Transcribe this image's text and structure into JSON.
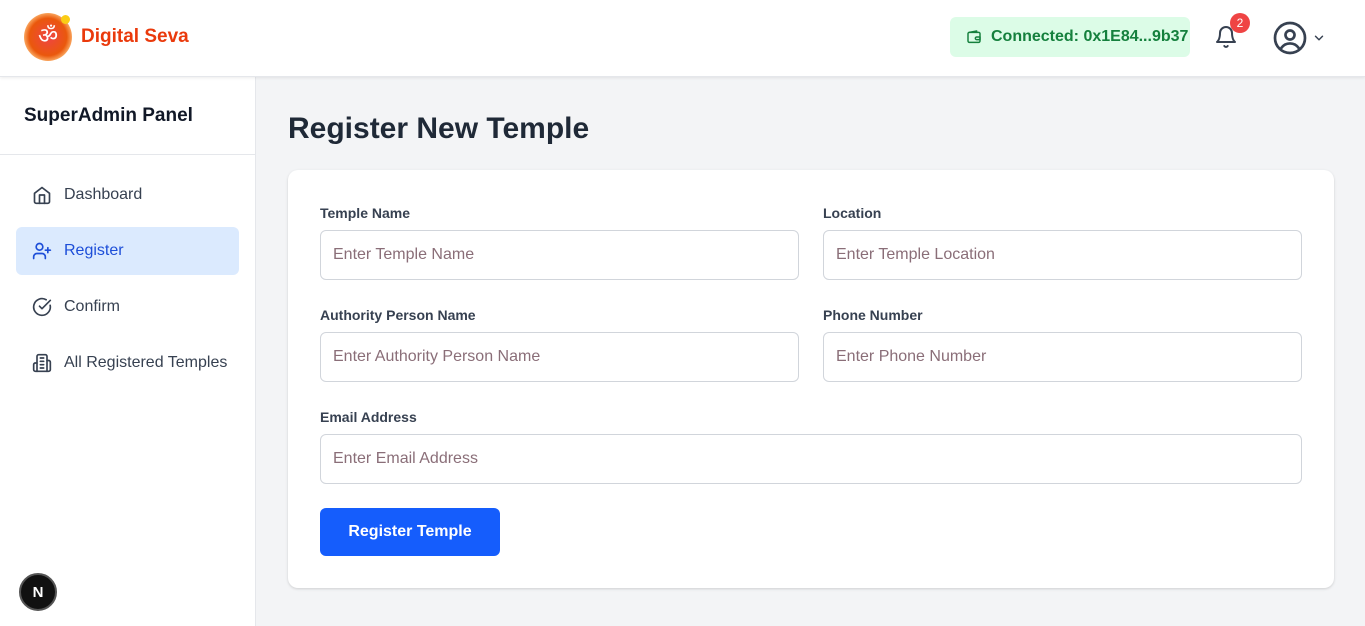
{
  "brand": {
    "name": "Digital Seva",
    "logo_glyph": "ॐ",
    "logo_icon": "om-logo-icon"
  },
  "header": {
    "wallet_status": "Connected: 0x1E84...9b37",
    "notification_count": "2"
  },
  "sidebar": {
    "title": "SuperAdmin Panel",
    "items": [
      {
        "label": "Dashboard",
        "icon": "home-icon",
        "active": false
      },
      {
        "label": "Register",
        "icon": "user-plus-icon",
        "active": true
      },
      {
        "label": "Confirm",
        "icon": "check-circle-icon",
        "active": false
      },
      {
        "label": "All Registered Temples",
        "icon": "building-icon",
        "active": false
      }
    ]
  },
  "page": {
    "title": "Register New Temple"
  },
  "form": {
    "temple_name": {
      "label": "Temple Name",
      "placeholder": "Enter Temple Name",
      "value": ""
    },
    "location": {
      "label": "Location",
      "placeholder": "Enter Temple Location",
      "value": ""
    },
    "authority": {
      "label": "Authority Person Name",
      "placeholder": "Enter Authority Person Name",
      "value": ""
    },
    "phone": {
      "label": "Phone Number",
      "placeholder": "Enter Phone Number",
      "value": ""
    },
    "email": {
      "label": "Email Address",
      "placeholder": "Enter Email Address",
      "value": ""
    },
    "submit_label": "Register Temple"
  },
  "dev_badge": {
    "letter": "N"
  },
  "colors": {
    "brand": "#ea3a0c",
    "accent": "#155dfc",
    "active_nav_bg": "#dbeafe",
    "wallet_bg": "#dcfce7",
    "wallet_text": "#15803d",
    "badge": "#ef4444"
  }
}
